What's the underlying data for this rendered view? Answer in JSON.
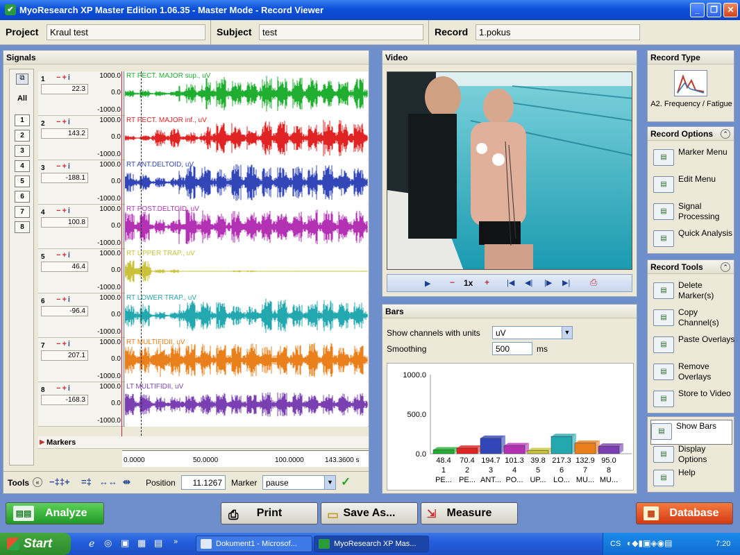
{
  "window": {
    "title": "MyoResearch XP Master Edition 1.06.35 - Master Mode - Record Viewer"
  },
  "info": {
    "project_label": "Project",
    "project_value": "Kraul test",
    "subject_label": "Subject",
    "subject_value": "test",
    "record_label": "Record",
    "record_value": "1.pokus"
  },
  "signals": {
    "title": "Signals",
    "all_label": "All",
    "channel_buttons": [
      "1",
      "2",
      "3",
      "4",
      "5",
      "6",
      "7",
      "8"
    ],
    "channels": [
      {
        "num": "1",
        "value": "22.3",
        "label": "RT PECT. MAJOR sup., uV",
        "ymax": "1000.0",
        "ymid": "0.0",
        "ymin": "-1000.0",
        "color": "#1fae2f"
      },
      {
        "num": "2",
        "value": "143.2",
        "label": "RT PECT. MAJOR inf., uV",
        "ymax": "1000.0",
        "ymid": "0.0",
        "ymin": "-1000.0",
        "color": "#e02424"
      },
      {
        "num": "3",
        "value": "-188.1",
        "label": "RT ANT.DELTOID, uV",
        "ymax": "1000.0",
        "ymid": "0.0",
        "ymin": "-1000.0",
        "color": "#3246b8"
      },
      {
        "num": "4",
        "value": "100.8",
        "label": "RT POST.DELTOID, uV",
        "ymax": "1000.0",
        "ymid": "0.0",
        "ymin": "-1000.0",
        "color": "#b331b3"
      },
      {
        "num": "5",
        "value": "46.4",
        "label": "RT UPPER TRAP., uV",
        "ymax": "1000.0",
        "ymid": "0.0",
        "ymin": "-1000.0",
        "color": "#c9c23a"
      },
      {
        "num": "6",
        "value": "-96.4",
        "label": "RT LOWER TRAP., uV",
        "ymax": "1000.0",
        "ymid": "0.0",
        "ymin": "-1000.0",
        "color": "#24a8b0"
      },
      {
        "num": "7",
        "value": "207.1",
        "label": "RT MULTIFIDII, uV",
        "ymax": "1000.0",
        "ymid": "0.0",
        "ymin": "-1000.0",
        "color": "#e9801c"
      },
      {
        "num": "8",
        "value": "-168.3",
        "label": "LT MULTIFIDII, uV",
        "ymax": "1000.0",
        "ymid": "0.0",
        "ymin": "-1000.0",
        "color": "#7a3fb0"
      }
    ],
    "markers_label": "Markers",
    "time_ticks": [
      "0.0000",
      "50.0000",
      "100.0000",
      "143.3600 s"
    ],
    "tools_label": "Tools",
    "position_label": "Position",
    "position_value": "11.1267",
    "marker_label": "Marker",
    "marker_value": "pause"
  },
  "video": {
    "title": "Video",
    "speed": "1x"
  },
  "bars": {
    "title": "Bars",
    "units_label": "Show channels with units",
    "units_value": "uV",
    "smoothing_label": "Smoothing",
    "smoothing_value": "500",
    "smoothing_unit": "ms",
    "chart_data": {
      "type": "bar",
      "ylim": [
        0,
        1000
      ],
      "yticks": [
        "1000.0",
        "500.0",
        "0.0"
      ],
      "categories": [
        "1",
        "2",
        "3",
        "4",
        "5",
        "6",
        "7",
        "8"
      ],
      "names": [
        "PE...",
        "PE...",
        "ANT...",
        "PO...",
        "UP...",
        "LO...",
        "MU...",
        "MU..."
      ],
      "value_labels": [
        "48.4",
        "70.4",
        "194.7",
        "101.3",
        "39.8",
        "217.3",
        "132.9",
        "95.0"
      ],
      "values": [
        48.4,
        70.4,
        194.7,
        101.3,
        39.8,
        217.3,
        132.9,
        95.0
      ],
      "colors": [
        "#1fae2f",
        "#e02424",
        "#3246b8",
        "#b331b3",
        "#c9c23a",
        "#24a8b0",
        "#e9801c",
        "#7a3fb0"
      ]
    }
  },
  "side": {
    "record_type_title": "Record Type",
    "record_type_label": "A2. Frequency / Fatigue",
    "record_options_title": "Record Options",
    "record_options": [
      {
        "label": "Marker Menu",
        "icon": "marker-menu-icon"
      },
      {
        "label": "Edit Menu",
        "icon": "edit-menu-icon"
      },
      {
        "label": "Signal Processing",
        "icon": "signal-processing-icon"
      },
      {
        "label": "Quick Analysis",
        "icon": "quick-analysis-icon"
      }
    ],
    "record_tools_title": "Record Tools",
    "record_tools": [
      {
        "label": "Delete Marker(s)",
        "icon": "delete-marker-icon"
      },
      {
        "label": "Copy Channel(s)",
        "icon": "copy-channel-icon"
      },
      {
        "label": "Paste Overlays",
        "icon": "paste-overlays-icon"
      },
      {
        "label": "Remove Overlays",
        "icon": "remove-overlays-icon"
      },
      {
        "label": "Store to Video",
        "icon": "store-video-icon"
      }
    ],
    "bottom": [
      {
        "label": "Show Bars",
        "icon": "show-bars-icon"
      },
      {
        "label": "Display Options",
        "icon": "display-options-icon"
      },
      {
        "label": "Help",
        "icon": "help-icon"
      }
    ]
  },
  "actions": {
    "analyze": "Analyze",
    "print": "Print",
    "save_as": "Save As...",
    "measure": "Measure",
    "database": "Database"
  },
  "taskbar": {
    "start": "Start",
    "task1": "Dokument1 - Microsof...",
    "task2": "MyoResearch XP Mas...",
    "lang": "CS",
    "time": "7:20"
  }
}
